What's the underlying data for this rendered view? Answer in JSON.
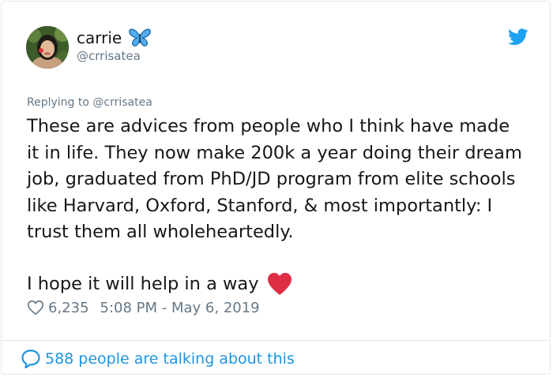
{
  "header": {
    "display_name": "carrie",
    "handle": "@crrisatea",
    "avatar_icon": "avatar-photo",
    "name_emoji": "butterfly-icon",
    "brand_icon": "twitter-bird-icon",
    "brand_color": "#1da1f2"
  },
  "reply": {
    "prefix": "Replying to",
    "mention": "@crrisatea"
  },
  "tweet": {
    "paragraph_1": "These are advices from people who I think have made it in life. They now make 200k a year doing their dream job, graduated from PhD/JD program from elite schools like Harvard, Oxford, Stanford, & most importantly: I trust them all wholeheartedly.",
    "paragraph_2": "I hope it will help in a way",
    "paragraph_2_emoji": "red-heart-icon"
  },
  "meta": {
    "likes": "6,235",
    "timestamp": "5:08 PM - May 6, 2019"
  },
  "footer": {
    "talking_text": "588 people are talking about this",
    "accent": "#1b95e0"
  }
}
